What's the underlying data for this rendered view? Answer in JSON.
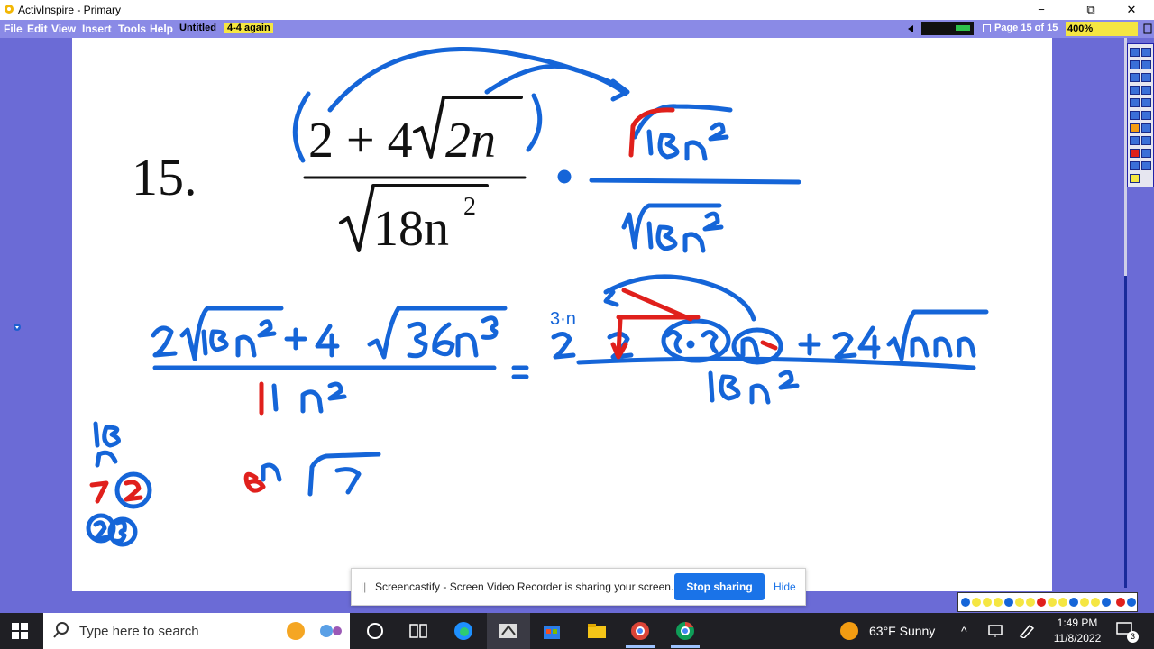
{
  "window": {
    "title": "ActivInspire - Primary",
    "minimize_glyph": "−",
    "restore_glyph": "⧉",
    "close_glyph": "✕"
  },
  "menu": {
    "items": [
      "File",
      "Edit",
      "View",
      "Insert",
      "Tools",
      "Help"
    ],
    "doc_tabs": [
      {
        "label": "Untitled",
        "active": false
      },
      {
        "label": "4-4 again",
        "active": true
      }
    ],
    "page_indicator": "Page 15 of 15",
    "zoom": "400%"
  },
  "problem": {
    "number": "15.",
    "numerator_left": "2 + 4",
    "numerator_radicand": "2n",
    "denominator_radicand": "18n",
    "exponent": "2"
  },
  "screen_share": {
    "grip": "||",
    "message": "Screencastify - Screen Video Recorder is sharing your screen.",
    "stop_label": "Stop sharing",
    "hide_label": "Hide"
  },
  "taskbar": {
    "search_placeholder": "Type here to search",
    "weather": "63°F  Sunny",
    "time": "1:49 PM",
    "date": "11/8/2022",
    "notification_count": "3",
    "up_glyph": "^"
  },
  "colors": {
    "ink_blue": "#1565d8",
    "ink_red": "#e0201c",
    "panel_purple": "#6b6bd6",
    "tab_yellow": "#f5e642",
    "share_button": "#1a73e8"
  }
}
